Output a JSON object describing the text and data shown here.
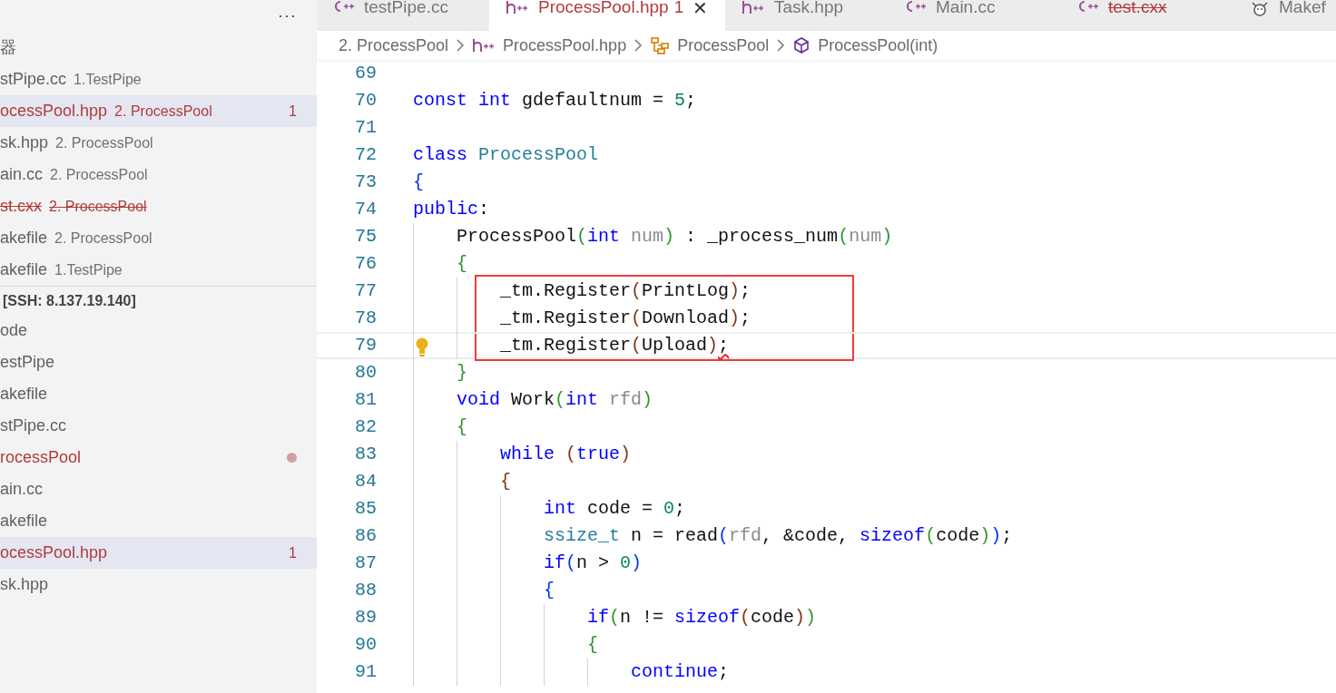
{
  "sidebar": {
    "more_label": "···",
    "open_editors_title": "器",
    "open_editors": [
      {
        "label": "stPipe.cc",
        "description": "1.TestPipe",
        "modified": false,
        "deleted": false,
        "selected": false
      },
      {
        "label": "ocessPool.hpp",
        "description": "2. ProcessPool",
        "modified": true,
        "deleted": false,
        "badge": "1",
        "selected": true
      },
      {
        "label": "sk.hpp",
        "description": "2. ProcessPool",
        "modified": false,
        "deleted": false,
        "selected": false
      },
      {
        "label": "ain.cc",
        "description": "2. ProcessPool",
        "modified": false,
        "deleted": false,
        "selected": false
      },
      {
        "label": "st.cxx",
        "description": "2. ProcessPool",
        "modified": false,
        "deleted": true,
        "selected": false
      },
      {
        "label": "akefile",
        "description": "2. ProcessPool",
        "modified": false,
        "deleted": false,
        "selected": false
      },
      {
        "label": "akefile",
        "description": "1.TestPipe",
        "modified": false,
        "deleted": false,
        "selected": false
      }
    ],
    "explorer_title": "[SSH: 8.137.19.140]",
    "explorer": [
      {
        "label": "ode",
        "modified": false,
        "dot": false,
        "selected": false
      },
      {
        "label": "estPipe",
        "modified": false,
        "dot": false,
        "selected": false
      },
      {
        "label": "akefile",
        "modified": false,
        "dot": false,
        "selected": false
      },
      {
        "label": "stPipe.cc",
        "modified": false,
        "dot": false,
        "selected": false
      },
      {
        "label": "rocessPool",
        "modified": true,
        "dot": true,
        "selected": false
      },
      {
        "label": "ain.cc",
        "modified": false,
        "dot": false,
        "selected": false
      },
      {
        "label": "akefile",
        "modified": false,
        "dot": false,
        "selected": false
      },
      {
        "label": "ocessPool.hpp",
        "modified": true,
        "dot": false,
        "badge": "1",
        "selected": true
      },
      {
        "label": "sk.hpp",
        "modified": false,
        "dot": false,
        "selected": false
      }
    ]
  },
  "tabs": [
    {
      "kind": "cpp",
      "label": "testPipe.cc",
      "modified": false,
      "deleted": false,
      "closable": false,
      "selected": false
    },
    {
      "kind": "hpp",
      "label": "ProcessPool.hpp",
      "modified": true,
      "deleted": false,
      "badge": "1",
      "closable": true,
      "selected": true
    },
    {
      "kind": "hpp",
      "label": "Task.hpp",
      "modified": false,
      "deleted": false,
      "closable": false,
      "selected": false
    },
    {
      "kind": "cpp",
      "label": "Main.cc",
      "modified": false,
      "deleted": false,
      "closable": false,
      "selected": false
    },
    {
      "kind": "cpp",
      "label": "test.cxx",
      "modified": false,
      "deleted": true,
      "closable": false,
      "selected": false
    },
    {
      "kind": "makefile",
      "label": "Makef",
      "modified": false,
      "deleted": false,
      "closable": false,
      "selected": false
    }
  ],
  "close_label": "✕",
  "breadcrumbs": [
    {
      "label": "2. ProcessPool"
    },
    {
      "kind": "hpp",
      "label": "ProcessPool.hpp"
    },
    {
      "kind": "class",
      "label": "ProcessPool"
    },
    {
      "kind": "method",
      "label": "ProcessPool(int)"
    }
  ],
  "editor": {
    "lines": [
      {
        "number": "69"
      },
      {
        "number": "70",
        "tokens": [
          {
            "t": "const",
            "kind": "kw"
          },
          {
            "t": " int",
            "kind": "kw"
          },
          {
            "t": " gdefaultnum = ",
            "kind": "p"
          },
          {
            "t": "5",
            "kind": "num"
          },
          {
            "t": ";",
            "kind": "p"
          }
        ]
      },
      {
        "number": "71"
      },
      {
        "number": "72",
        "tokens": [
          {
            "t": "class",
            "kind": "kw"
          },
          {
            "t": " ProcessPool",
            "kind": "type"
          }
        ]
      },
      {
        "number": "73",
        "tokens": [
          {
            "t": "{",
            "kind": "bb"
          }
        ]
      },
      {
        "number": "74",
        "tokens": [
          {
            "t": "public",
            "kind": "kw"
          },
          {
            "t": ":",
            "kind": "p"
          }
        ],
        "children": [
          {
            "number": "75",
            "tokens": [
              {
                "t": "ProcessPool",
                "kind": "p"
              },
              {
                "t": "(",
                "kind": "bg"
              },
              {
                "t": "int",
                "kind": "kw"
              },
              {
                "t": " num",
                "kind": "param"
              },
              {
                "t": ")",
                "kind": "bg"
              },
              {
                "t": " : _process_num",
                "kind": "p"
              },
              {
                "t": "(",
                "kind": "bg"
              },
              {
                "t": "num",
                "kind": "param"
              },
              {
                "t": ")",
                "kind": "bg"
              }
            ]
          },
          {
            "number": "76",
            "tokens": [
              {
                "t": "{",
                "kind": "bg"
              }
            ],
            "children": [
              {
                "number": "77",
                "boxed": true,
                "tokens": [
                  {
                    "t": "_tm.Register",
                    "kind": "p"
                  },
                  {
                    "t": "(",
                    "kind": "bbr"
                  },
                  {
                    "t": "PrintLog",
                    "kind": "p"
                  },
                  {
                    "t": ")",
                    "kind": "bbr"
                  },
                  {
                    "t": ";",
                    "kind": "p"
                  }
                ]
              },
              {
                "number": "78",
                "boxed": true,
                "tokens": [
                  {
                    "t": "_tm.Register",
                    "kind": "p"
                  },
                  {
                    "t": "(",
                    "kind": "bbr"
                  },
                  {
                    "t": "Download",
                    "kind": "p"
                  },
                  {
                    "t": ")",
                    "kind": "bbr"
                  },
                  {
                    "t": ";",
                    "kind": "p"
                  }
                ]
              },
              {
                "number": "79",
                "boxed": true,
                "current": true,
                "lightbulb": true,
                "tokens": [
                  {
                    "t": "_tm.Register",
                    "kind": "p"
                  },
                  {
                    "t": "(",
                    "kind": "bbr"
                  },
                  {
                    "t": "Upload",
                    "kind": "p"
                  },
                  {
                    "t": ")",
                    "kind": "bbr"
                  },
                  {
                    "t": ";",
                    "kind": "p",
                    "error": true
                  }
                ]
              }
            ]
          },
          {
            "number": "80",
            "tokens": [
              {
                "t": "}",
                "kind": "bg"
              }
            ]
          },
          {
            "number": "81",
            "tokens": [
              {
                "t": "void",
                "kind": "kw"
              },
              {
                "t": " Work",
                "kind": "p"
              },
              {
                "t": "(",
                "kind": "bg"
              },
              {
                "t": "int",
                "kind": "kw"
              },
              {
                "t": " rfd",
                "kind": "param"
              },
              {
                "t": ")",
                "kind": "bg"
              }
            ]
          },
          {
            "number": "82",
            "tokens": [
              {
                "t": "{",
                "kind": "bg"
              }
            ],
            "children": [
              {
                "number": "83",
                "tokens": [
                  {
                    "t": "while",
                    "kind": "kw"
                  },
                  {
                    "t": " (",
                    "kind": "bbr"
                  },
                  {
                    "t": "true",
                    "kind": "kw"
                  },
                  {
                    "t": ")",
                    "kind": "bbr"
                  }
                ]
              },
              {
                "number": "84",
                "tokens": [
                  {
                    "t": "{",
                    "kind": "bbr"
                  }
                ],
                "children": [
                  {
                    "number": "85",
                    "tokens": [
                      {
                        "t": "int",
                        "kind": "kw"
                      },
                      {
                        "t": " code = ",
                        "kind": "p"
                      },
                      {
                        "t": "0",
                        "kind": "num"
                      },
                      {
                        "t": ";",
                        "kind": "p"
                      }
                    ]
                  },
                  {
                    "number": "86",
                    "tokens": [
                      {
                        "t": "ssize_t",
                        "kind": "type"
                      },
                      {
                        "t": " n = read",
                        "kind": "p"
                      },
                      {
                        "t": "(",
                        "kind": "bb"
                      },
                      {
                        "t": "rfd",
                        "kind": "param"
                      },
                      {
                        "t": ", &code, ",
                        "kind": "p"
                      },
                      {
                        "t": "sizeof",
                        "kind": "kw"
                      },
                      {
                        "t": "(",
                        "kind": "bg"
                      },
                      {
                        "t": "code",
                        "kind": "p"
                      },
                      {
                        "t": ")",
                        "kind": "bg"
                      },
                      {
                        "t": ")",
                        "kind": "bb"
                      },
                      {
                        "t": ";",
                        "kind": "p"
                      }
                    ]
                  },
                  {
                    "number": "87",
                    "tokens": [
                      {
                        "t": "if",
                        "kind": "kw"
                      },
                      {
                        "t": "(",
                        "kind": "bb"
                      },
                      {
                        "t": "n > ",
                        "kind": "p"
                      },
                      {
                        "t": "0",
                        "kind": "num"
                      },
                      {
                        "t": ")",
                        "kind": "bb"
                      }
                    ]
                  },
                  {
                    "number": "88",
                    "tokens": [
                      {
                        "t": "{",
                        "kind": "bb"
                      }
                    ],
                    "children": [
                      {
                        "number": "89",
                        "tokens": [
                          {
                            "t": "if",
                            "kind": "kw"
                          },
                          {
                            "t": "(",
                            "kind": "bg"
                          },
                          {
                            "t": "n != ",
                            "kind": "p"
                          },
                          {
                            "t": "sizeof",
                            "kind": "kw"
                          },
                          {
                            "t": "(",
                            "kind": "bbr"
                          },
                          {
                            "t": "code",
                            "kind": "p"
                          },
                          {
                            "t": ")",
                            "kind": "bbr"
                          },
                          {
                            "t": ")",
                            "kind": "bg"
                          }
                        ]
                      },
                      {
                        "number": "90",
                        "tokens": [
                          {
                            "t": "{",
                            "kind": "bg"
                          }
                        ],
                        "children": [
                          {
                            "number": "91",
                            "tokens": [
                              {
                                "t": "continue",
                                "kind": "kw"
                              },
                              {
                                "t": ";",
                                "kind": "p"
                              }
                            ]
                          }
                        ]
                      }
                    ]
                  }
                ]
              }
            ]
          }
        ]
      }
    ]
  }
}
